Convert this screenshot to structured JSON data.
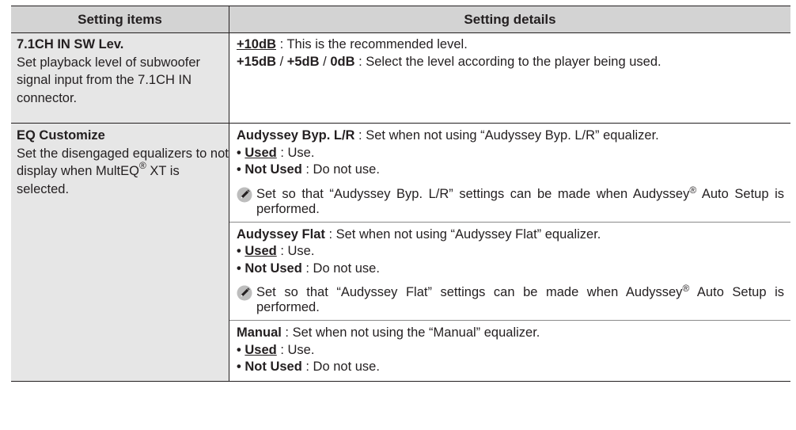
{
  "header": {
    "left": "Setting items",
    "right": "Setting details"
  },
  "rows": [
    {
      "item_title": "7.1CH IN SW Lev.",
      "item_desc": "Set playback level of subwoofer signal input from the 7.1CH IN connector.",
      "details": {
        "line1_value": "+10dB",
        "line1_text": " : This is the recommended level.",
        "line2_v1": "+15dB",
        "line2_v2": "+5dB",
        "line2_v3": "0dB",
        "line2_sep": " / ",
        "line2_text": " : Select the level according to the player being used."
      }
    },
    {
      "item_title": "EQ Customize",
      "item_desc_a": "Set the disengaged equalizers to not display when MultEQ",
      "item_desc_reg": "®",
      "item_desc_b": " XT is selected.",
      "sections": [
        {
          "name": "Audyssey Byp. L/R",
          "desc": " : Set when not using “Audyssey Byp. L/R” equalizer.",
          "opt1_label": "Used",
          "opt1_text": " : Use.",
          "opt2_label": "Not Used",
          "opt2_text": " : Do not use.",
          "bullet": "• ",
          "note_a": "Set so that “Audyssey Byp. L/R” settings can be made when Audyssey",
          "note_reg": "®",
          "note_b": " Auto Setup is performed."
        },
        {
          "name": "Audyssey Flat",
          "desc": " : Set when not using “Audyssey Flat” equalizer.",
          "opt1_label": "Used",
          "opt1_text": " : Use.",
          "opt2_label": "Not Used",
          "opt2_text": " : Do not use.",
          "bullet": "• ",
          "note_a": "Set so that “Audyssey Flat” settings can be made when Audyssey",
          "note_reg": "®",
          "note_b": " Auto Setup is performed."
        },
        {
          "name": "Manual",
          "desc": " : Set when not using the “Manual” equalizer.",
          "opt1_label": "Used",
          "opt1_text": " : Use.",
          "opt2_label": "Not Used",
          "opt2_text": " : Do not use.",
          "bullet": "• "
        }
      ]
    }
  ],
  "icons": {
    "note": "pencil-icon"
  },
  "colors": {
    "header_bg": "#d3d3d3",
    "item_bg": "#e6e6e6",
    "text": "#231f20"
  }
}
